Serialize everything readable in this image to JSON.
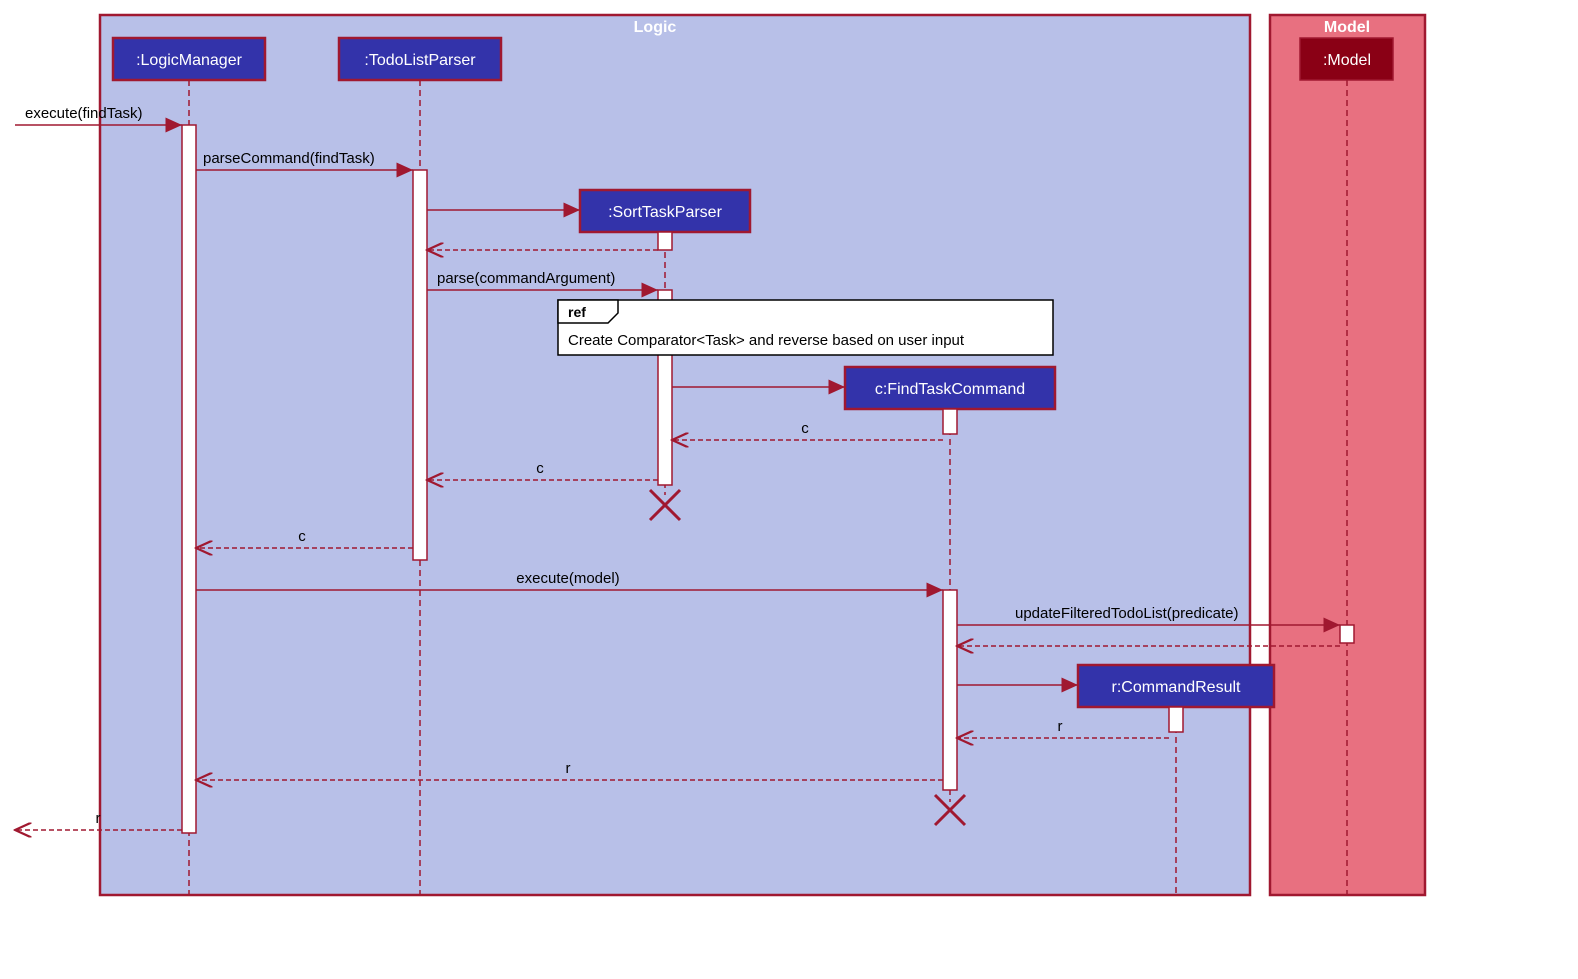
{
  "frames": {
    "logic": {
      "label": "Logic"
    },
    "model": {
      "label": "Model"
    }
  },
  "participants": {
    "logicManager": ":LogicManager",
    "todoListParser": ":TodoListParser",
    "sortTaskParser": ":SortTaskParser",
    "findTaskCommand": "c:FindTaskCommand",
    "commandResult": "r:CommandResult",
    "model": ":Model"
  },
  "messages": {
    "m1": "execute(findTask)",
    "m2": "parseCommand(findTask)",
    "m3": "parse(commandArgument)",
    "m4_c1": "c",
    "m4_c2": "c",
    "m4_c3": "c",
    "m5": "execute(model)",
    "m6": "updateFilteredTodoList(predicate)",
    "m7_r1": "r",
    "m7_r2": "r",
    "m8_r": "r"
  },
  "ref": {
    "label": "ref",
    "text": "Create Comparator<Task> and reverse based on user input"
  }
}
